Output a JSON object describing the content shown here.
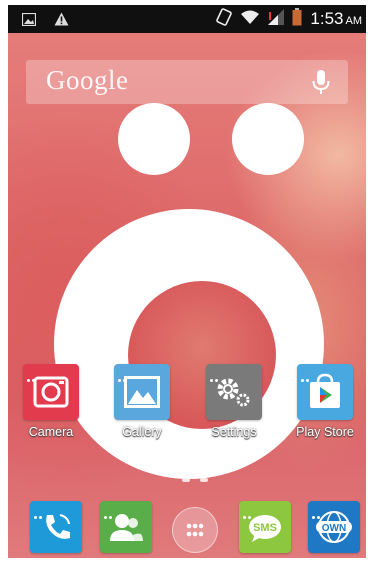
{
  "status_bar": {
    "time": "1:53",
    "ampm": "AM",
    "left_icons": [
      "image-notification-icon",
      "warning-icon"
    ],
    "right_icons": [
      "screen-rotate-icon",
      "wifi-icon",
      "signal-icon",
      "battery-icon"
    ]
  },
  "search": {
    "logo_text": "Google",
    "voice_icon": "mic-icon"
  },
  "apps": [
    {
      "label": "Camera",
      "icon": "camera-icon",
      "color": "#e23b4e"
    },
    {
      "label": "Gallery",
      "icon": "gallery-icon",
      "color": "#5aa7dd"
    },
    {
      "label": "Settings",
      "icon": "settings-icon",
      "color": "#7a7a7a"
    },
    {
      "label": "Play Store",
      "icon": "play-store-icon",
      "color": "#4aa8e0"
    }
  ],
  "dock": [
    {
      "name": "phone",
      "icon": "phone-icon",
      "color": "#1e9ad8"
    },
    {
      "name": "contacts",
      "icon": "contacts-icon",
      "color": "#5aae4a"
    },
    {
      "name": "app-drawer",
      "icon": "app-drawer-icon",
      "color": "#ffffff"
    },
    {
      "name": "sms",
      "icon": "sms-icon",
      "color": "#8dc63f",
      "text": "SMS"
    },
    {
      "name": "browser",
      "icon": "globe-icon",
      "color": "#1f78c4",
      "text": "OWN"
    }
  ],
  "page_indicator": {
    "pages": 2,
    "current": 1
  }
}
